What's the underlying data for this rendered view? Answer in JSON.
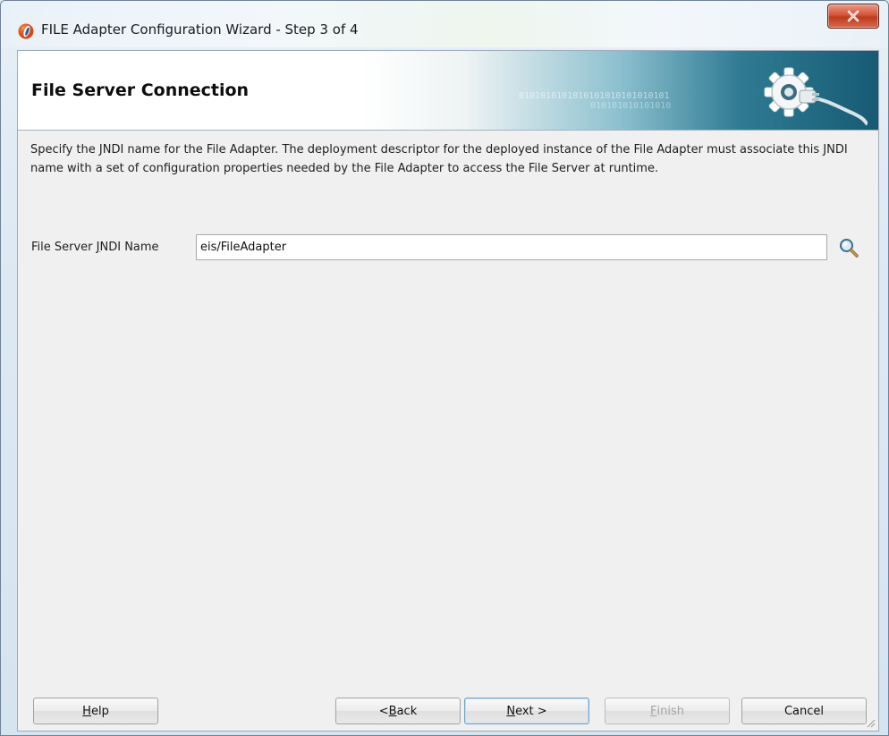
{
  "window": {
    "title": "FILE Adapter Configuration Wizard - Step 3 of 4",
    "close_icon": "close-icon"
  },
  "header": {
    "title": "File Server Connection",
    "binary_1": "0101010101010101010101010101",
    "binary_2": "010101010101010"
  },
  "description": "Specify the JNDI name for the File Adapter. The deployment descriptor for the deployed instance of the File Adapter must associate this JNDI name with a set of configuration properties needed by the File Adapter to access the File Server at runtime.",
  "jndi": {
    "label_before": "File Server ",
    "label_mnemonic": "J",
    "label_after": "NDI Name",
    "value": "eis/FileAdapter",
    "search_icon": "magnifier-icon"
  },
  "buttons": {
    "help": {
      "mnemonic": "H",
      "rest": "elp"
    },
    "back": {
      "prefix": "< ",
      "mnemonic": "B",
      "rest": "ack"
    },
    "next": {
      "mnemonic": "N",
      "rest": "ext >"
    },
    "finish": {
      "mnemonic": "F",
      "rest": "inish"
    },
    "cancel": {
      "label": "Cancel"
    }
  },
  "colors": {
    "close_red": "#c13a1e",
    "header_teal": "#175a73",
    "dialog_bg": "#f0f0f0"
  }
}
